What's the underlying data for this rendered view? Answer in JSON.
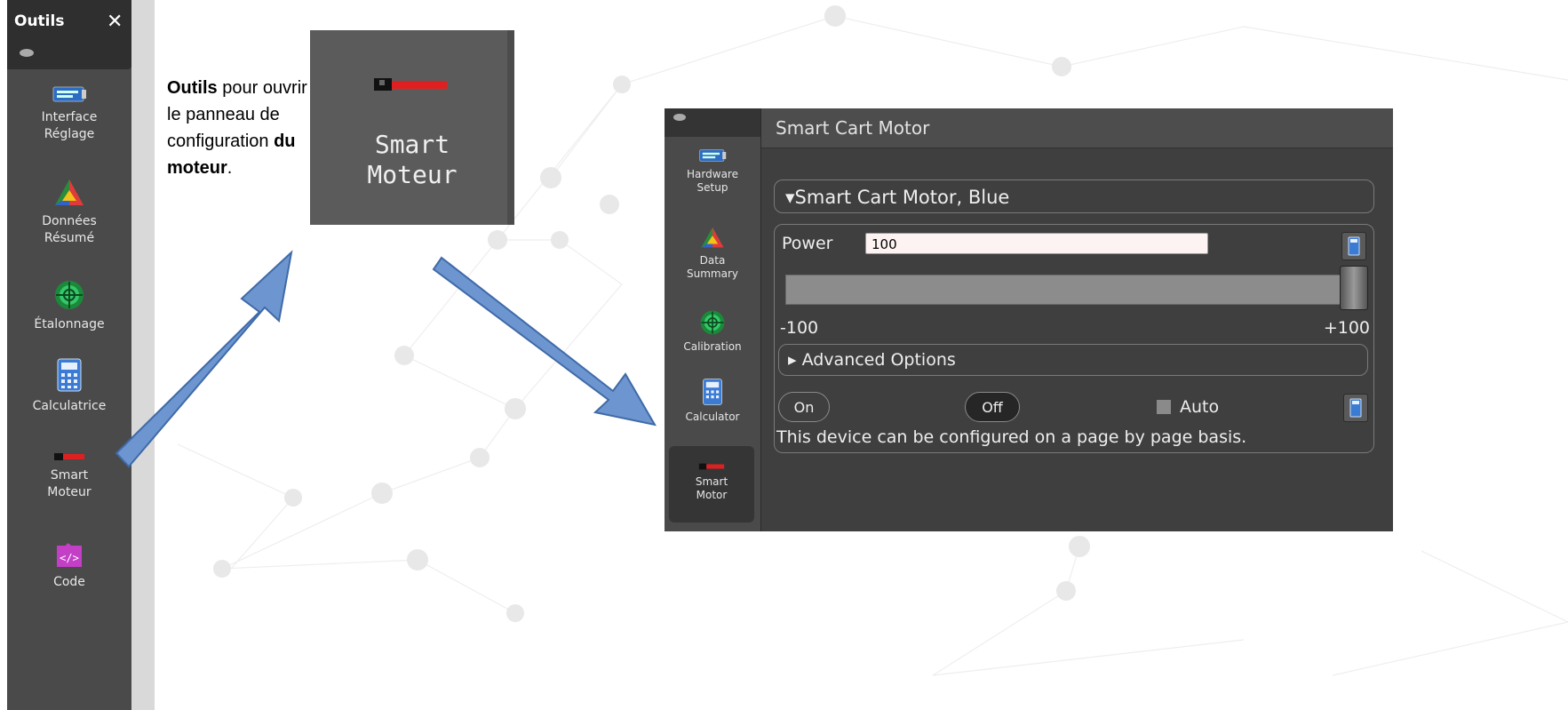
{
  "tools_panel": {
    "title": "Outils",
    "close": "✕",
    "items": [
      {
        "icon": "hardware-setup-icon",
        "label": "Interface\nRéglage"
      },
      {
        "icon": "data-summary-icon",
        "label": "Données\nRésumé"
      },
      {
        "icon": "calibration-icon",
        "label": "Étalonnage"
      },
      {
        "icon": "calculator-icon",
        "label": "Calculatrice"
      },
      {
        "icon": "smart-motor-icon",
        "label": "Smart\nMoteur"
      },
      {
        "icon": "code-icon",
        "label": "Code"
      }
    ]
  },
  "note": {
    "bold1": "Outils",
    "text1": " pour ouvrir le panneau de configuration ",
    "bold2": "du moteur",
    "text2": "."
  },
  "zoom_tile": {
    "label": "Smart\nMoteur"
  },
  "window": {
    "sidebar": [
      {
        "icon": "hardware-setup-icon",
        "label": "Hardware\nSetup"
      },
      {
        "icon": "data-summary-icon",
        "label": "Data\nSummary"
      },
      {
        "icon": "calibration-icon",
        "label": "Calibration"
      },
      {
        "icon": "calculator-icon",
        "label": "Calculator"
      },
      {
        "icon": "smart-motor-icon",
        "label": "Smart\nMotor"
      }
    ],
    "title": "Smart Cart Motor",
    "device_header": "▾Smart Cart Motor, Blue",
    "power_label": "Power",
    "power_value": "100",
    "range_min": "-100",
    "range_max": "+100",
    "advanced_label": "▸ Advanced Options",
    "on_label": "On",
    "off_label": "Off",
    "auto_label": "Auto",
    "message": "This device can be configured on a page by page basis."
  },
  "colors": {
    "arrow_fill": "#6d95cf",
    "arrow_stroke": "#3f6aa8",
    "panel_bg": "#4a4a4a",
    "window_bg": "#3f3f3f"
  }
}
